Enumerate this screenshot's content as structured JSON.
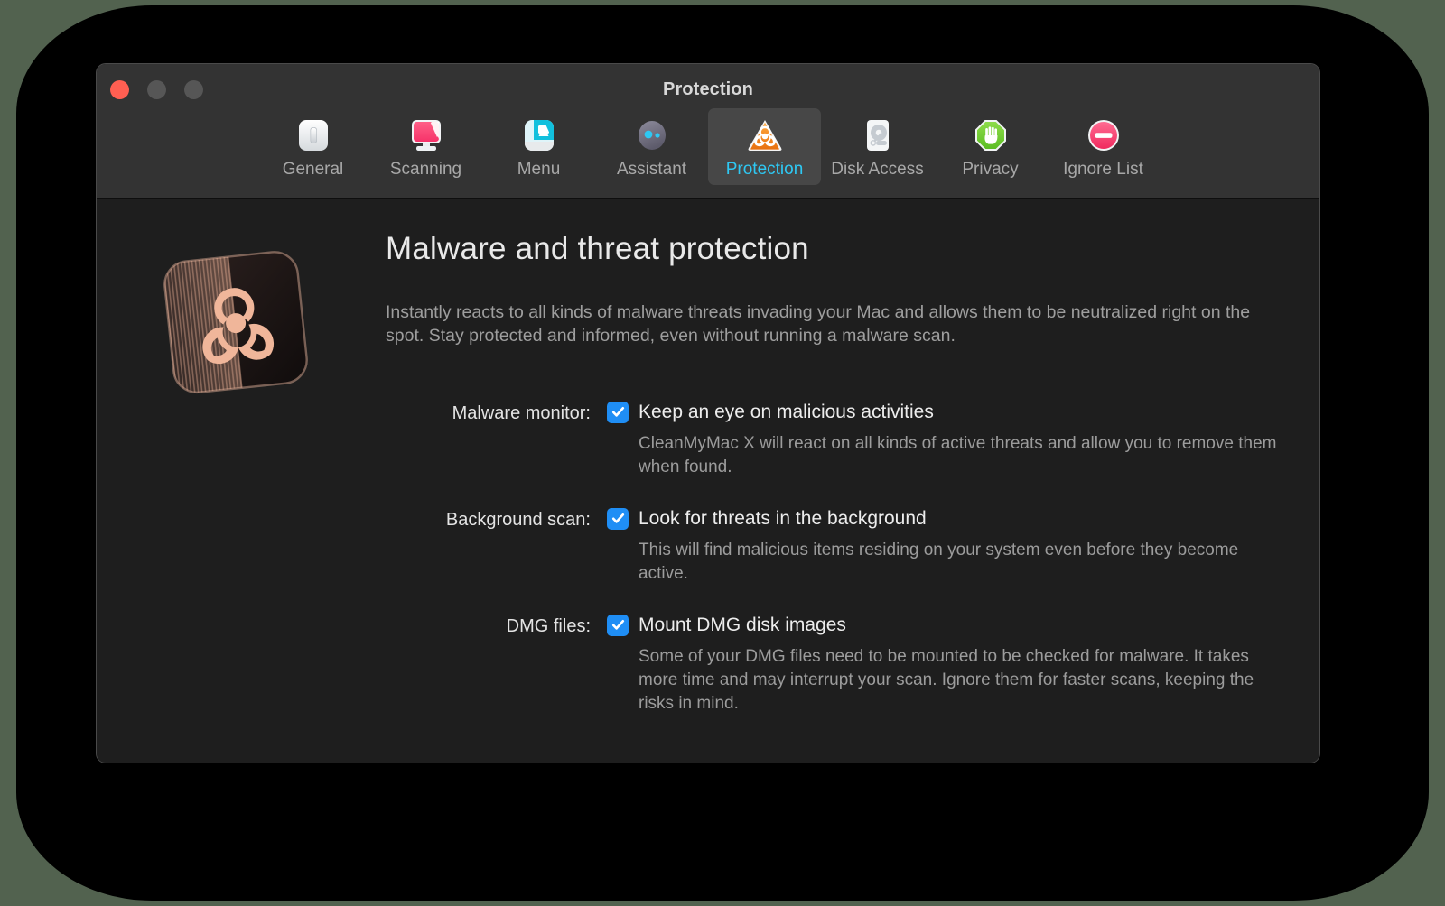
{
  "window": {
    "title": "Protection",
    "traffic_lights": [
      {
        "name": "close",
        "color": "#ff5f52"
      },
      {
        "name": "minimize",
        "color": "#565656"
      },
      {
        "name": "zoom",
        "color": "#565656"
      }
    ]
  },
  "colors": {
    "page_background": "#52624f",
    "backdrop": "#000000",
    "toolbar": "#333333",
    "content": "#1e1e1e",
    "accent_selected_text": "#2ec8f3",
    "selected_tab_background": "#474747",
    "checkbox_blue": "#1f8ef5",
    "hero_accent": "#f0b69a"
  },
  "toolbar": {
    "tabs": [
      {
        "label": "General",
        "icon": "toggle-switch-icon",
        "selected": false
      },
      {
        "label": "Scanning",
        "icon": "monitor-scan-icon",
        "selected": false
      },
      {
        "label": "Menu",
        "icon": "menu-display-icon",
        "selected": false
      },
      {
        "label": "Assistant",
        "icon": "assistant-face-icon",
        "selected": false
      },
      {
        "label": "Protection",
        "icon": "biohazard-triangle-icon",
        "selected": true
      },
      {
        "label": "Disk Access",
        "icon": "hard-disk-icon",
        "selected": false
      },
      {
        "label": "Privacy",
        "icon": "stop-hand-icon",
        "selected": false
      },
      {
        "label": "Ignore List",
        "icon": "minus-circle-icon",
        "selected": false
      }
    ]
  },
  "main": {
    "hero_icon": "biohazard-card-icon",
    "heading": "Malware and threat protection",
    "description": "Instantly reacts to all kinds of malware threats invading your Mac and allows them to be neutralized right on the spot. Stay protected and informed, even without running a malware scan.",
    "settings": [
      {
        "label": "Malware monitor:",
        "checkbox_label": "Keep an eye on malicious activities",
        "checked": true,
        "hint": "CleanMyMac X will react on all kinds of active threats and allow you to remove them when found."
      },
      {
        "label": "Background scan:",
        "checkbox_label": "Look for threats in the background",
        "checked": true,
        "hint": "This will find malicious items residing on your system even before they become active."
      },
      {
        "label": "DMG files:",
        "checkbox_label": "Mount DMG disk images",
        "checked": true,
        "hint": "Some of your DMG files need to be mounted to be checked for malware. It takes more time and may interrupt your scan. Ignore them for faster scans, keeping the risks in mind."
      }
    ]
  }
}
